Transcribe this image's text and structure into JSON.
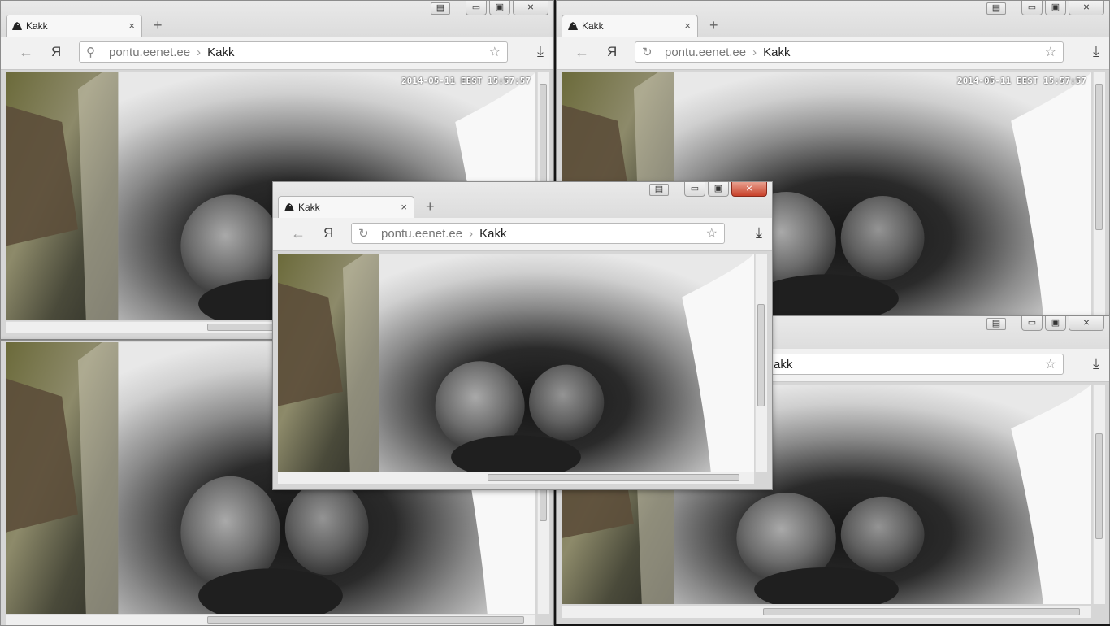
{
  "tab": {
    "title": "Kakk",
    "close": "×",
    "new_tab": "+"
  },
  "window_buttons": {
    "menu": "▤",
    "minimize": "▭",
    "maximize": "▣",
    "close": "⨯"
  },
  "nav": {
    "back": "←",
    "yandex": "Я",
    "reload": "↻",
    "search": "⚲",
    "download": "⤓",
    "star": "☆"
  },
  "address": {
    "host": "pontu.eenet.ee",
    "separator": "›",
    "page": "Kakk"
  },
  "partial_address": {
    "page": "akk"
  },
  "camera": {
    "timestamp": "2014-05-11 EEST 15:57:57"
  },
  "icons": [
    "owl-favicon-icon",
    "back-arrow-icon",
    "yandex-icon",
    "search-icon",
    "reload-icon",
    "star-icon",
    "download-icon"
  ]
}
